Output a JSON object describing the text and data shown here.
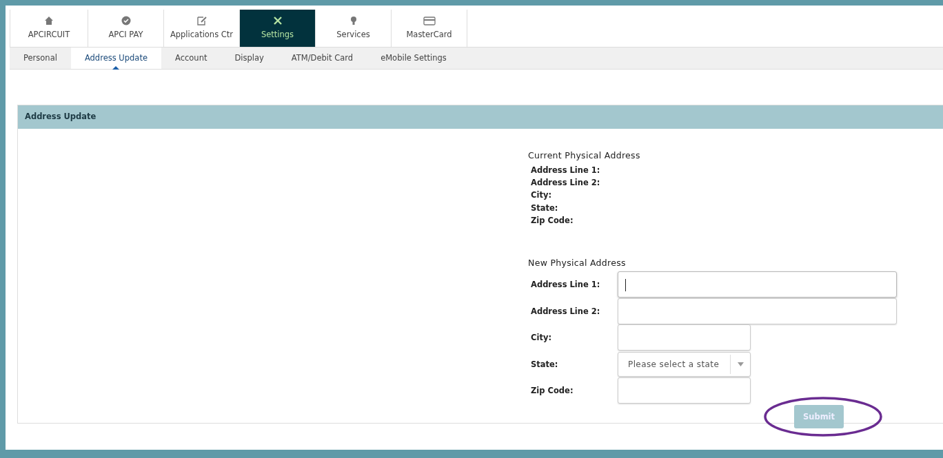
{
  "main_tabs": [
    {
      "label": "APCIRCUIT",
      "selected": false
    },
    {
      "label": "APCI PAY",
      "selected": false
    },
    {
      "label": "Applications Ctr",
      "selected": false
    },
    {
      "label": "Settings",
      "selected": true
    },
    {
      "label": "Services",
      "selected": false
    },
    {
      "label": "MasterCard",
      "selected": false
    }
  ],
  "sub_tabs": [
    {
      "label": "Personal",
      "selected": false
    },
    {
      "label": "Address Update",
      "selected": true
    },
    {
      "label": "Account",
      "selected": false
    },
    {
      "label": "Display",
      "selected": false
    },
    {
      "label": "ATM/Debit Card",
      "selected": false
    },
    {
      "label": "eMobile Settings",
      "selected": false
    }
  ],
  "panel": {
    "title": "Address Update",
    "current": {
      "heading": "Current Physical Address",
      "labels": [
        "Address Line 1:",
        "Address Line 2:",
        "City:",
        "State:",
        "Zip Code:"
      ]
    },
    "new": {
      "heading": "New Physical Address",
      "fields": [
        {
          "label": "Address Line 1:",
          "kind": "text",
          "focused": true
        },
        {
          "label": "Address Line 2:",
          "kind": "text",
          "focused": false
        },
        {
          "label": "City:",
          "kind": "text",
          "focused": false
        },
        {
          "label": "State:",
          "kind": "select",
          "placeholder": "Please select a state"
        },
        {
          "label": "Zip Code:",
          "kind": "text",
          "focused": false
        }
      ]
    },
    "submit": {
      "label": "Submit",
      "disabled": true,
      "circled": true
    }
  }
}
